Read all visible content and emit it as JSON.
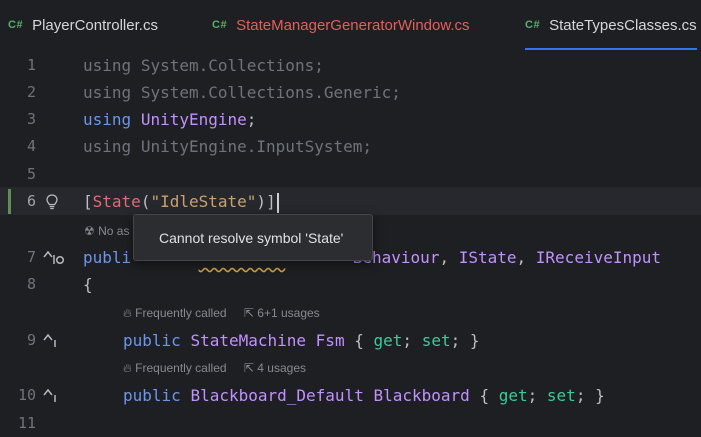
{
  "tabs": [
    {
      "badge": "C#",
      "label": "PlayerController.cs",
      "state": "normal"
    },
    {
      "badge": "C#",
      "label": "StateManagerGeneratorWindow.cs",
      "state": "error"
    },
    {
      "badge": "C#",
      "label": "StateTypesClasses.cs",
      "state": "normal"
    }
  ],
  "gutter": {
    "line_numbers": [
      "1",
      "2",
      "3",
      "4",
      "5",
      "6",
      "7",
      "8",
      "9",
      "10",
      "11"
    ],
    "icons": {
      "line6": "bulb-icon",
      "line7": "implemented-up-icon",
      "line9": "implemented-up-icon",
      "line10": "implemented-up-icon"
    }
  },
  "code": {
    "l1": {
      "kw": "using",
      "ns": "System.Collections",
      "end": ";"
    },
    "l2": {
      "kw": "using",
      "ns": "System.Collections.Generic",
      "end": ";"
    },
    "l3": {
      "kw": "using",
      "ns": "UnityEngine",
      "end": ";"
    },
    "l4": {
      "kw": "using",
      "ns": "UnityEngine.InputSystem",
      "end": ";"
    },
    "l6": {
      "open": "[",
      "attr": "State",
      "lparen": "(",
      "str": "\"IdleState\"",
      "rparen": ")",
      "close": "]"
    },
    "l6_hint": "No as",
    "l7": {
      "kw": "publi",
      "hidden_squiggle": "         ",
      "rest1": "Behaviour",
      "comma1": ", ",
      "iface1": "IState",
      "comma2": ", ",
      "iface2": "IReceiveInput"
    },
    "l8": "{",
    "l9": {
      "kw": "public",
      "type": "StateMachine",
      "name": "Fsm",
      "open": "{",
      "get": "get",
      "semi1": ";",
      "set": "set",
      "semi2": ";",
      "close": "}"
    },
    "l10": {
      "kw": "public",
      "type": "Blackboard_Default",
      "name": "Blackboard",
      "open": "{",
      "get": "get",
      "semi1": ";",
      "set": "set",
      "semi2": ";",
      "close": "}"
    }
  },
  "hints": {
    "h1": {
      "called": "Frequently called",
      "usages": "6+1 usages"
    },
    "h2": {
      "called": "Frequently called",
      "usages": "4 usages"
    }
  },
  "tooltip": {
    "text": "Cannot resolve symbol 'State'"
  },
  "colors": {
    "keyword": "#6c95eb",
    "type": "#c191ff",
    "attribute_error": "#e06c75",
    "string": "#c9a26d",
    "accessor": "#39cc9b",
    "tab_active_underline": "#3574f0"
  }
}
